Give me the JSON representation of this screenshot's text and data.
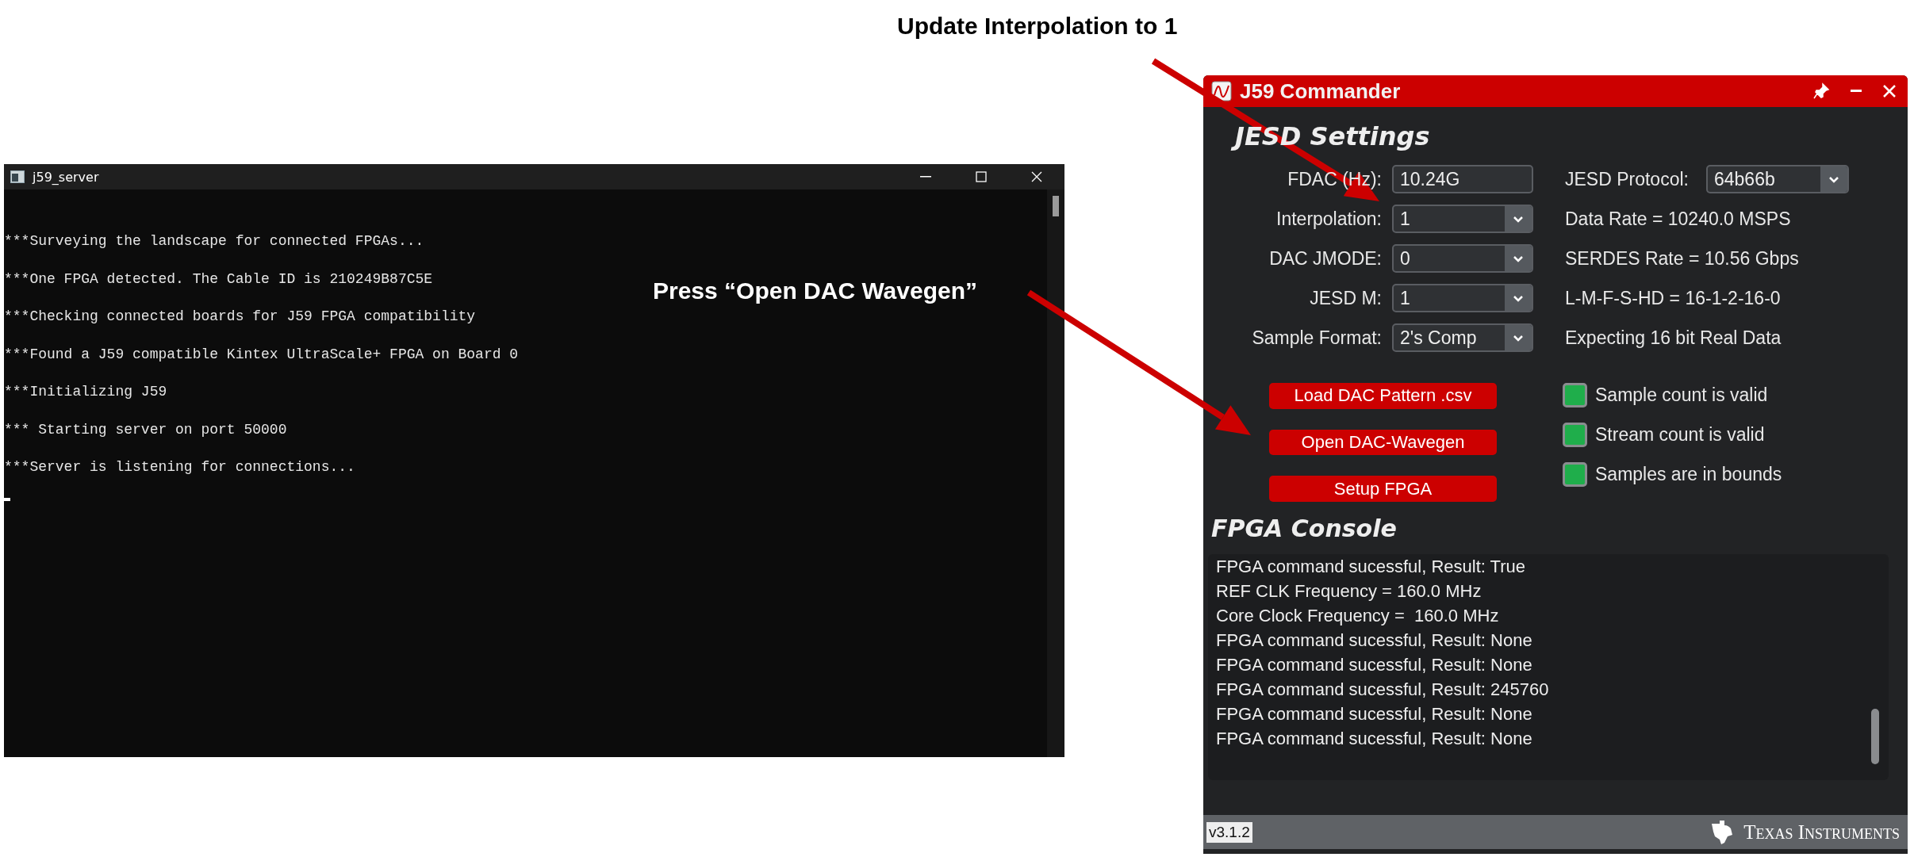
{
  "annotations": [
    {
      "text": "Update Interpolation to 1"
    },
    {
      "text": "Press “Open DAC Wavegen”"
    }
  ],
  "server_window": {
    "title": "j59_server",
    "lines": [
      "***Surveying the landscape for connected FPGAs...",
      "***One FPGA detected. The Cable ID is 210249B87C5E",
      "***Checking connected boards for J59 FPGA compatibility",
      "***Found a J59 compatible Kintex UltraScale+ FPGA on Board 0",
      "***Initializing J59",
      "*** Starting server on port 50000",
      "***Server is listening for connections..."
    ]
  },
  "commander": {
    "title": "J59 Commander",
    "settings_heading": "JESD Settings",
    "fields": [
      {
        "kind": "text",
        "label": "FDAC (Hz):",
        "value": "10.24G"
      },
      {
        "kind": "dropdown",
        "label": "Interpolation:",
        "value": "1"
      },
      {
        "kind": "dropdown",
        "label": "DAC JMODE:",
        "value": "0"
      },
      {
        "kind": "dropdown",
        "label": "JESD M:",
        "value": "1"
      },
      {
        "kind": "dropdown",
        "label": "Sample Format:",
        "value": "2's Comp"
      }
    ],
    "protocol": {
      "label": "JESD Protocol:",
      "value": "64b66b"
    },
    "info": [
      "Data Rate = 10240.0 MSPS",
      "SERDES Rate = 10.56 Gbps",
      "L-M-F-S-HD = 16-1-2-16-0",
      "Expecting 16 bit Real Data"
    ],
    "buttons": [
      "Load DAC Pattern .csv",
      "Open DAC-Wavegen",
      "Setup FPGA"
    ],
    "indicators": [
      {
        "label": "Sample count is valid",
        "on": true
      },
      {
        "label": "Stream count is valid",
        "on": true
      },
      {
        "label": "Samples are in bounds",
        "on": true
      }
    ],
    "console_heading": "FPGA Console",
    "console_lines": [
      "FPGA command sucessful, Result: True",
      "REF CLK Frequency = 160.0 MHz",
      "Core Clock Frequency =  160.0 MHz",
      "FPGA command sucessful, Result: None",
      "FPGA command sucessful, Result: None",
      "FPGA command sucessful, Result: 245760",
      "FPGA command sucessful, Result: None",
      "FPGA command sucessful, Result: None"
    ],
    "version": "v3.1.2",
    "brand": "Texas Instruments"
  }
}
